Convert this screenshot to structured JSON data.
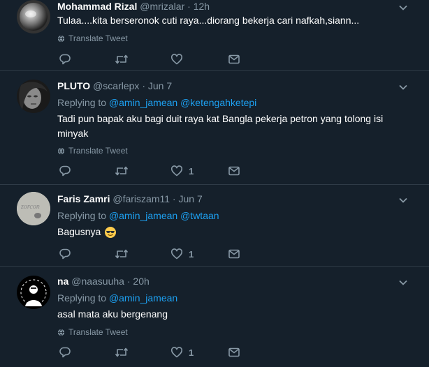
{
  "ui": {
    "translate_label": "Translate Tweet",
    "replying_label": "Replying to",
    "dot": "·"
  },
  "tweets": [
    {
      "name": "Mohammad Rizal",
      "handle": "@mrizalar",
      "time": "12h",
      "replying_to": [],
      "text": "Tulaa....kita berseronok cuti raya...diorang bekerja cari nafkah,siann...",
      "likes": "",
      "translate": true
    },
    {
      "name": "PLUTO",
      "handle": "@scarlepx",
      "time": "Jun 7",
      "replying_to": [
        "@amin_jamean",
        "@ketengahketepi"
      ],
      "text": "Tadi pun bapak aku bagi duit raya kat Bangla pekerja petron yang tolong isi minyak",
      "likes": "1",
      "translate": true
    },
    {
      "name": "Faris Zamri",
      "handle": "@fariszam11",
      "time": "Jun 7",
      "replying_to": [
        "@amin_jamean",
        "@twtaan"
      ],
      "text": "Bagusnya",
      "emoji": "smiling-face-with-sunglasses",
      "likes": "1",
      "translate": false
    },
    {
      "name": "na",
      "handle": "@naasuuha",
      "time": "20h",
      "replying_to": [
        "@amin_jamean"
      ],
      "text": "asal mata aku bergenang",
      "likes": "1",
      "translate": true
    }
  ],
  "colors": {
    "background": "#15202b",
    "secondary_text": "#8899a6",
    "link": "#1da1f2",
    "divider": "#2f3b47"
  }
}
